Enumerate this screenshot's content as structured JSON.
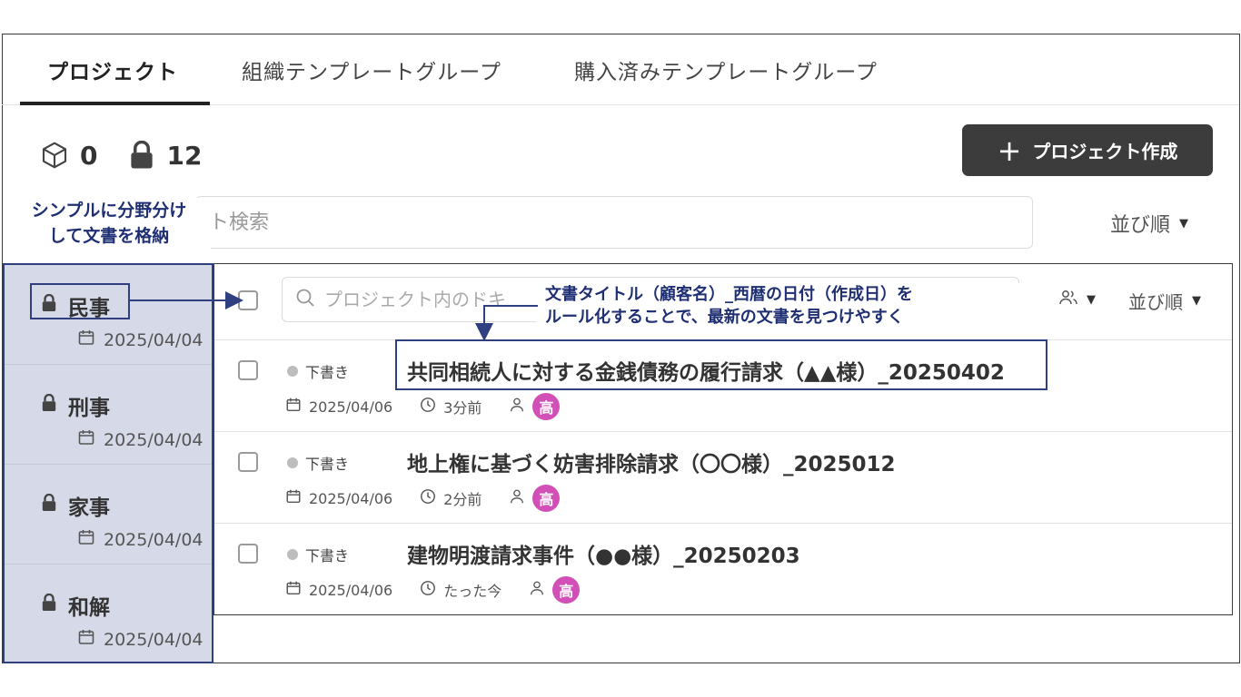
{
  "tabs": [
    {
      "label": "プロジェクト",
      "active": true
    },
    {
      "label": "組織テンプレートグループ",
      "active": false
    },
    {
      "label": "購入済みテンプレートグループ",
      "active": false
    }
  ],
  "stats": {
    "open_count": "0",
    "locked_count": "12"
  },
  "create_button": {
    "label": "プロジェクト作成"
  },
  "project_search": {
    "placeholder": "ト検索"
  },
  "sort_label": "並び順",
  "annotation_left": {
    "line1": "シンプルに分野分け",
    "line2": "して文書を格納"
  },
  "projects": [
    {
      "name": "民事",
      "date": "2025/04/04"
    },
    {
      "name": "刑事",
      "date": "2025/04/04"
    },
    {
      "name": "家事",
      "date": "2025/04/04"
    },
    {
      "name": "和解",
      "date": "2025/04/04"
    }
  ],
  "doc_search": {
    "placeholder": "プロジェクト内のドキ"
  },
  "doc_sort_label": "並び順",
  "annotation_right": {
    "line1": "文書タイトル（顧客名）_西暦の日付（作成日）を",
    "line2": "ルール化することで、最新の文書を見つけやすく"
  },
  "documents": [
    {
      "status": "下書き",
      "title": "共同相続人に対する金銭債務の履行請求（▲▲様）_20250402",
      "date": "2025/04/06",
      "time": "3分前",
      "avatar": "高"
    },
    {
      "status": "下書き",
      "title": "地上権に基づく妨害排除請求（〇〇様）_2025012",
      "date": "2025/04/06",
      "time": "2分前",
      "avatar": "高"
    },
    {
      "status": "下書き",
      "title": "建物明渡請求事件（●●様）_20250203",
      "date": "2025/04/06",
      "time": "たった今",
      "avatar": "高"
    }
  ],
  "colors": {
    "accent_box": "#2f3f80",
    "avatar": "#d24fb8",
    "sidebar_bg": "#d6d9e8",
    "button_bg": "#3c3c3c"
  }
}
